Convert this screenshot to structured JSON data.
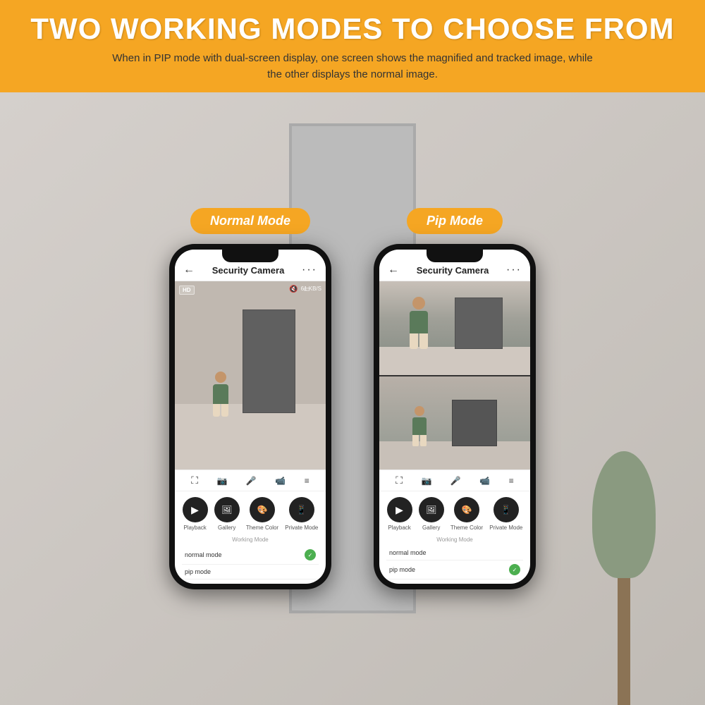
{
  "header": {
    "title": "TWO WORKING MODES TO CHOOSE FROM",
    "subtitle": "When in PIP mode with dual-screen display, one screen shows the magnified and tracked image, while the other displays the normal image."
  },
  "modes": [
    {
      "id": "normal",
      "badge": "Normal Mode",
      "app": {
        "title": "Security Camera",
        "hd_badge": "HD",
        "speed": "61 KB/S",
        "back_icon": "←",
        "more_icon": "···",
        "toolbar_icons": [
          "⛶",
          "📷",
          "🎤",
          "📹",
          "≡"
        ],
        "action_buttons": [
          {
            "label": "Playback",
            "icon": "▶"
          },
          {
            "label": "Gallery",
            "icon": "🖼"
          },
          {
            "label": "Theme Color",
            "icon": "🎨"
          },
          {
            "label": "Private Mode",
            "icon": "📱"
          }
        ],
        "working_mode_title": "Working Mode",
        "modes": [
          {
            "label": "normal mode",
            "selected": true
          },
          {
            "label": "pip mode",
            "selected": false
          }
        ]
      }
    },
    {
      "id": "pip",
      "badge": "Pip Mode",
      "app": {
        "title": "Security Camera",
        "back_icon": "←",
        "more_icon": "···",
        "toolbar_icons": [
          "⛶",
          "📷",
          "🎤",
          "📹",
          "≡"
        ],
        "action_buttons": [
          {
            "label": "Playback",
            "icon": "▶"
          },
          {
            "label": "Gallery",
            "icon": "🖼"
          },
          {
            "label": "Theme Color",
            "icon": "🎨"
          },
          {
            "label": "Private Mode",
            "icon": "📱"
          }
        ],
        "working_mode_title": "Working Mode",
        "modes": [
          {
            "label": "normal mode",
            "selected": false
          },
          {
            "label": "pip mode",
            "selected": true
          }
        ]
      }
    }
  ],
  "colors": {
    "orange": "#f5a623",
    "dark": "#111111",
    "green": "#4CAF50"
  }
}
